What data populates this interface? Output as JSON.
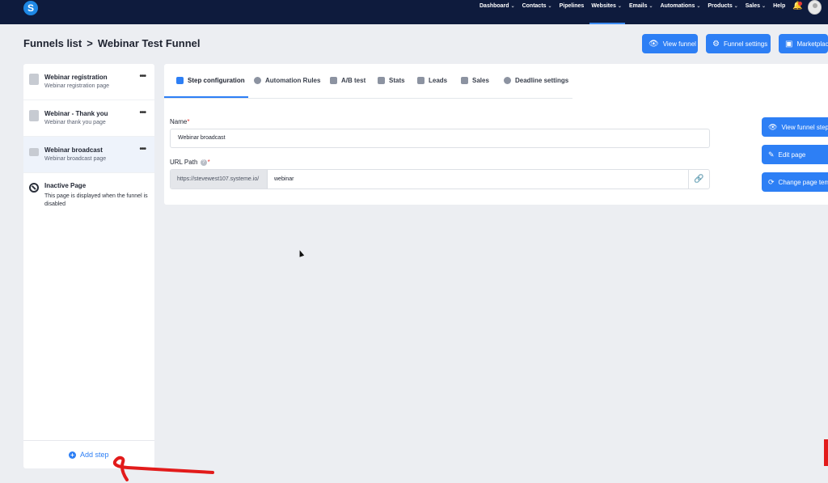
{
  "topnav": {
    "logo": "S",
    "items": [
      {
        "label": "Dashboard",
        "chevron": true
      },
      {
        "label": "Contacts",
        "chevron": true
      },
      {
        "label": "Pipelines",
        "chevron": false
      },
      {
        "label": "Websites",
        "chevron": true,
        "active": true
      },
      {
        "label": "Emails",
        "chevron": true
      },
      {
        "label": "Automations",
        "chevron": true
      },
      {
        "label": "Products",
        "chevron": true
      },
      {
        "label": "Sales",
        "chevron": true
      },
      {
        "label": "Help",
        "chevron": false
      }
    ]
  },
  "header": {
    "breadcrumb_root": "Funnels list",
    "breadcrumb_sep": ">",
    "breadcrumb_current": "Webinar Test Funnel",
    "buttons": {
      "view_funnel": "View funnel",
      "funnel_settings": "Funnel settings",
      "marketplace": "Marketplace"
    }
  },
  "steps": [
    {
      "title": "Webinar registration",
      "subtitle": "Webinar registration page",
      "icon": "page-icon"
    },
    {
      "title": "Webinar - Thank you",
      "subtitle": "Webinar thank you page",
      "icon": "clipboard-icon"
    },
    {
      "title": "Webinar broadcast",
      "subtitle": "Webinar broadcast page",
      "icon": "video-icon",
      "selected": true
    }
  ],
  "inactive": {
    "title": "Inactive Page",
    "description": "This page is displayed when the funnel is disabled"
  },
  "add_step": "Add step",
  "tabs": [
    {
      "label": "Step configuration",
      "active": true
    },
    {
      "label": "Automation Rules"
    },
    {
      "label": "A/B test"
    },
    {
      "label": "Stats"
    },
    {
      "label": "Leads"
    },
    {
      "label": "Sales"
    },
    {
      "label": "Deadline settings"
    }
  ],
  "form": {
    "name_label": "Name",
    "required_mark": "*",
    "name_value": "Webinar broadcast",
    "url_label": "URL Path",
    "url_prefix": "https://stevewest107.systeme.io/",
    "url_value": "webinar"
  },
  "side_buttons": {
    "view_step": "View funnel step",
    "edit_page": "Edit page",
    "change_template": "Change page template"
  },
  "colors": {
    "nav_bg": "#0e1b3d",
    "accent": "#2d7ff5",
    "annotation": "#e21b1b"
  }
}
